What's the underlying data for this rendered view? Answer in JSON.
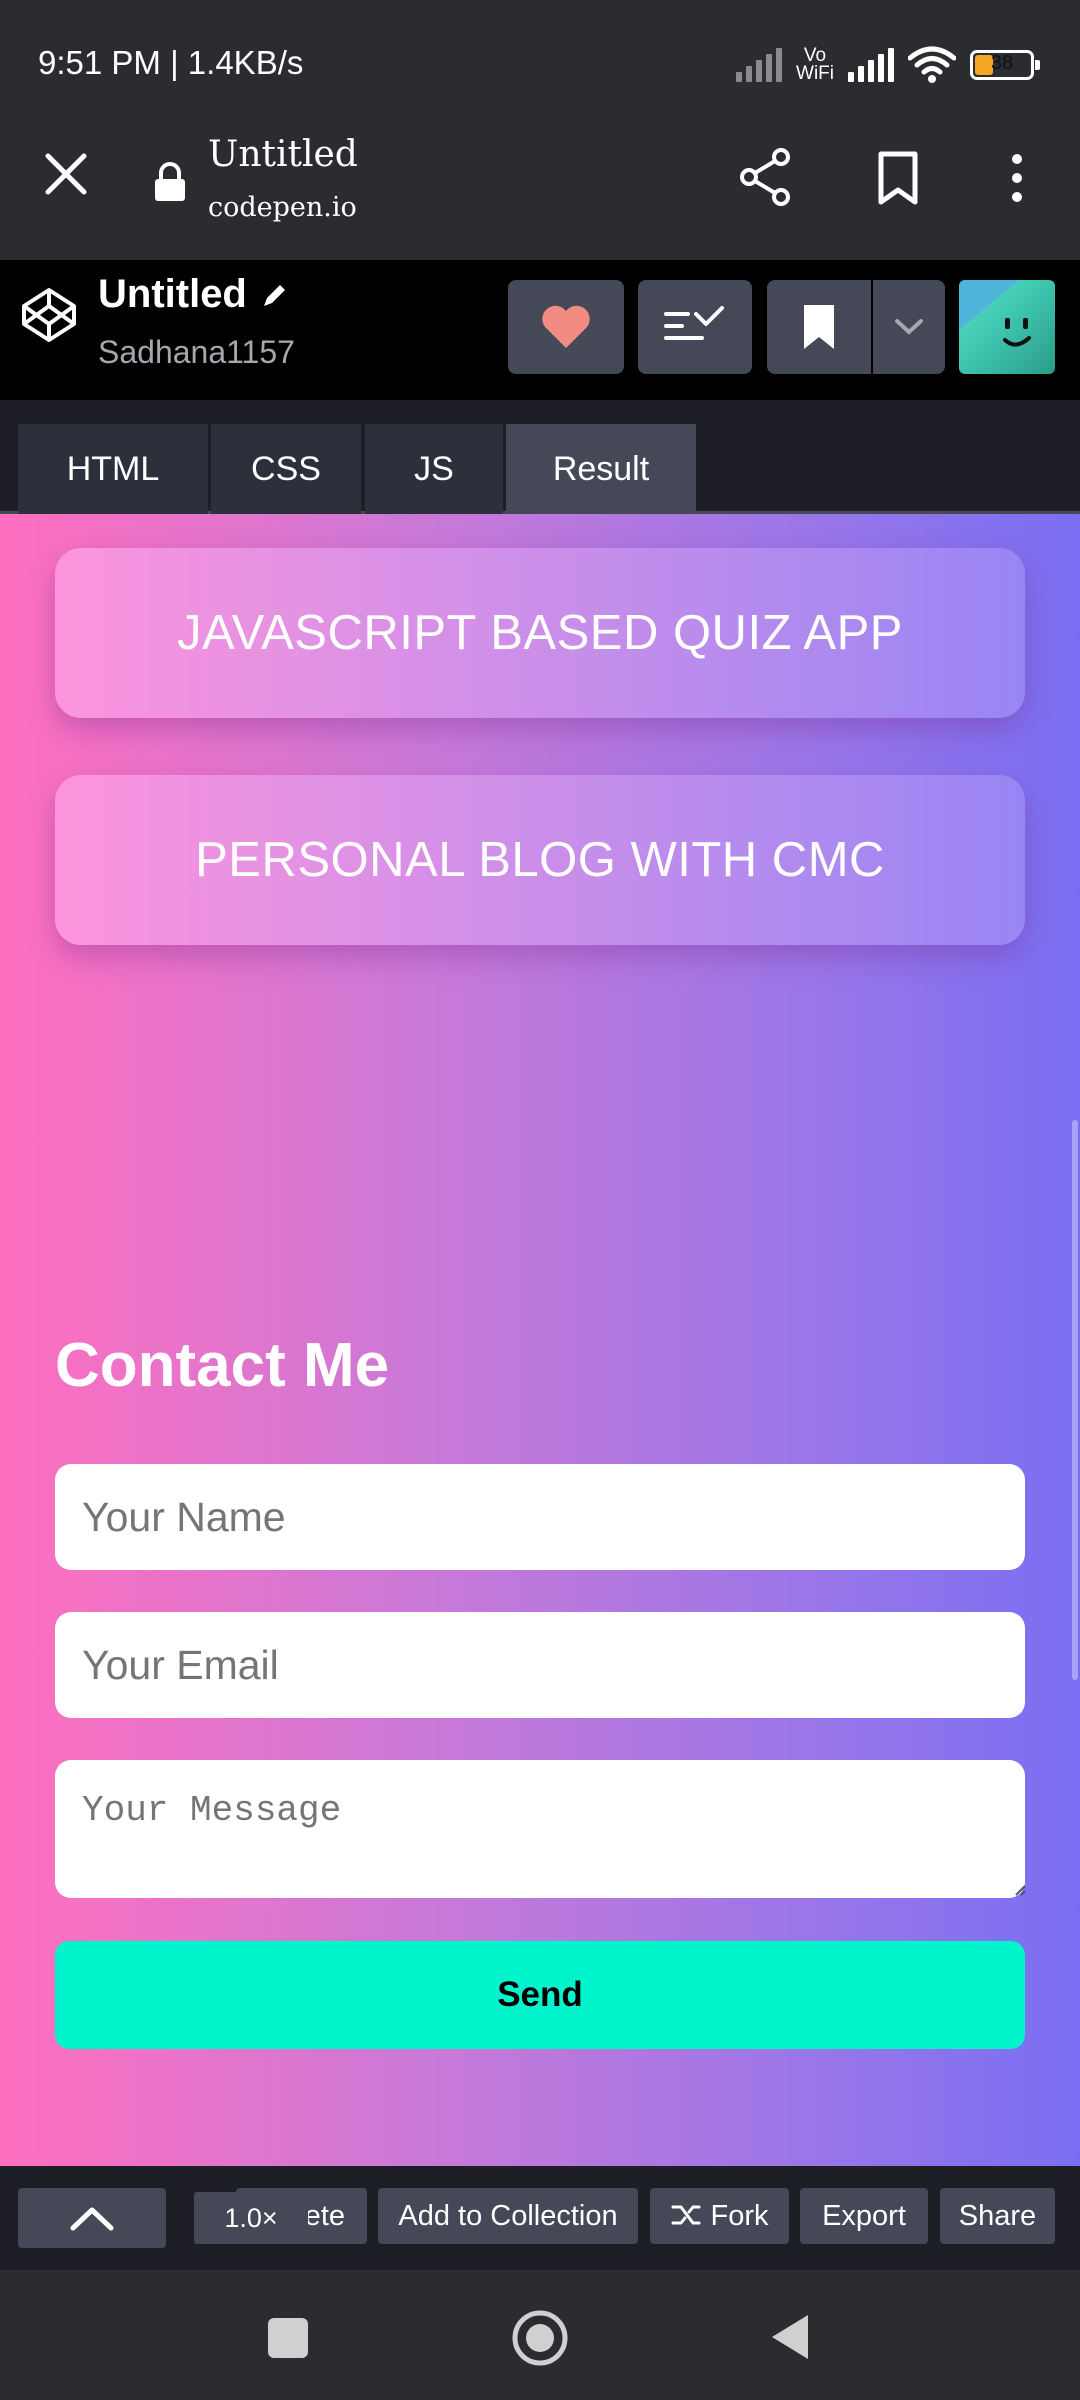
{
  "status_bar": {
    "time": "9:51 PM | 1.4KB/s",
    "vowifi_top": "Vo",
    "vowifi_bottom": "WiFi",
    "battery": "38"
  },
  "browser": {
    "page_title": "Untitled",
    "host": "codepen.io"
  },
  "codepen_header": {
    "pen_title": "Untitled",
    "username": "Sadhana1157"
  },
  "tabs": [
    {
      "label": "HTML"
    },
    {
      "label": "CSS"
    },
    {
      "label": "JS"
    },
    {
      "label": "Result"
    }
  ],
  "active_tab": "Result",
  "result": {
    "projects": [
      {
        "label": "JAVASCRIPT BASED QUIZ APP"
      },
      {
        "label": "PERSONAL BLOG WITH CMC"
      }
    ],
    "contact": {
      "title": "Contact Me",
      "name_placeholder": "Your Name",
      "email_placeholder": "Your Email",
      "message_placeholder": "Your Message",
      "send_label": "Send"
    }
  },
  "bottom_bar": {
    "zoom": "1.0×",
    "delete_label": "Delete",
    "add_collection_label": "Add to Collection",
    "fork_label": "Fork",
    "export_label": "Export",
    "share_label": "Share"
  },
  "colors": {
    "send_button": "#00f5cc",
    "heart": "#f28b82",
    "gradient_left": "#ff6fbf",
    "gradient_right": "#7a6ff2"
  }
}
